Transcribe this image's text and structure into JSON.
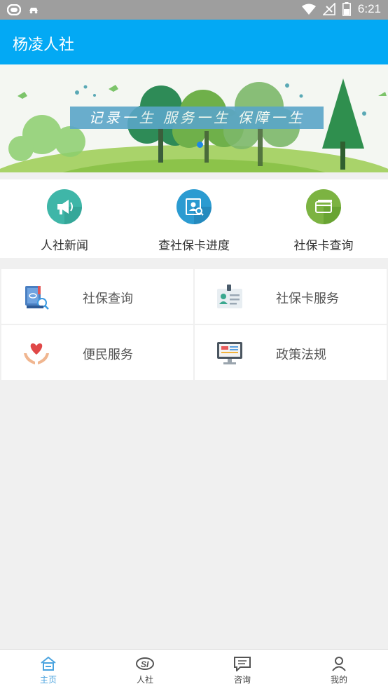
{
  "status_bar": {
    "time": "6:21"
  },
  "app_bar": {
    "title": "杨凌人社"
  },
  "banner": {
    "slogan": "记录一生 服务一生 保障一生"
  },
  "quick_actions": [
    {
      "label": "人社新闻",
      "icon": "megaphone-icon",
      "color": "#3fb6a8"
    },
    {
      "label": "查社保卡进度",
      "icon": "id-search-icon",
      "color": "#2b9bd1"
    },
    {
      "label": "社保卡查询",
      "icon": "card-icon",
      "color": "#7cb342"
    }
  ],
  "services": [
    {
      "label": "社保查询",
      "icon": "book-search-icon"
    },
    {
      "label": "社保卡服务",
      "icon": "id-badge-icon"
    },
    {
      "label": "便民服务",
      "icon": "heart-hands-icon"
    },
    {
      "label": "政策法规",
      "icon": "monitor-icon"
    }
  ],
  "bottom_nav": [
    {
      "label": "主页",
      "icon": "home-icon",
      "active": true
    },
    {
      "label": "人社",
      "icon": "si-icon",
      "active": false
    },
    {
      "label": "咨询",
      "icon": "chat-icon",
      "active": false
    },
    {
      "label": "我的",
      "icon": "person-icon",
      "active": false
    }
  ],
  "colors": {
    "primary": "#03a9f4",
    "status_bar": "#9e9e9e",
    "active_tab": "#4aa3df"
  }
}
